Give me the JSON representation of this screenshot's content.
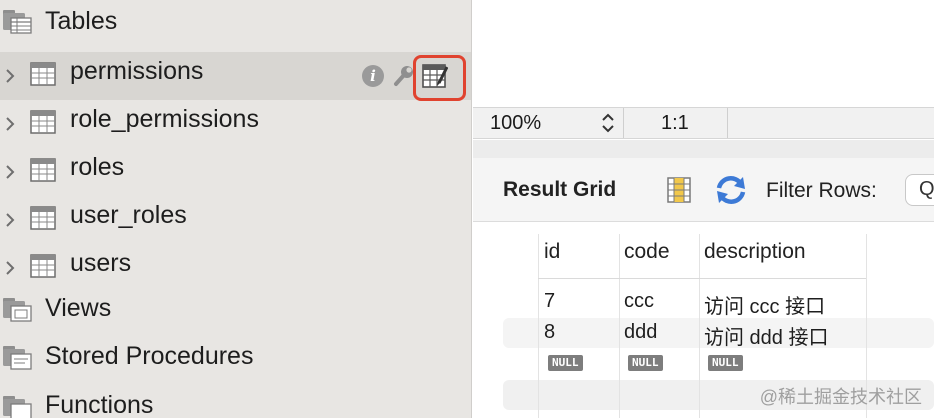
{
  "navigator": {
    "tables_folder": "Tables",
    "tables": [
      {
        "label": "permissions",
        "selected": true
      },
      {
        "label": "role_permissions",
        "selected": false
      },
      {
        "label": "roles",
        "selected": false
      },
      {
        "label": "user_roles",
        "selected": false
      },
      {
        "label": "users",
        "selected": false
      }
    ],
    "views_folder": "Views",
    "procedures_folder": "Stored Procedures",
    "functions_folder": "Functions",
    "row_actions": {
      "info_glyph": "i",
      "info_icon": "info-icon",
      "wrench_icon": "wrench-icon",
      "select_rows_icon": "table-grid-icon",
      "highlight_color": "#e0432f"
    }
  },
  "zoombar": {
    "zoom": "100%",
    "ratio": "1:1"
  },
  "result_toolbar": {
    "title": "Result Grid",
    "filter_label": "Filter Rows:",
    "filter_placeholder": "Q"
  },
  "grid": {
    "columns": [
      "id",
      "code",
      "description"
    ],
    "rows": [
      [
        "7",
        "ccc",
        "访问 ccc 接口"
      ],
      [
        "8",
        "ddd",
        "访问 ddd 接口"
      ],
      [
        "NULL",
        "NULL",
        "NULL"
      ]
    ]
  },
  "watermark": "@稀土掘金技术社区"
}
